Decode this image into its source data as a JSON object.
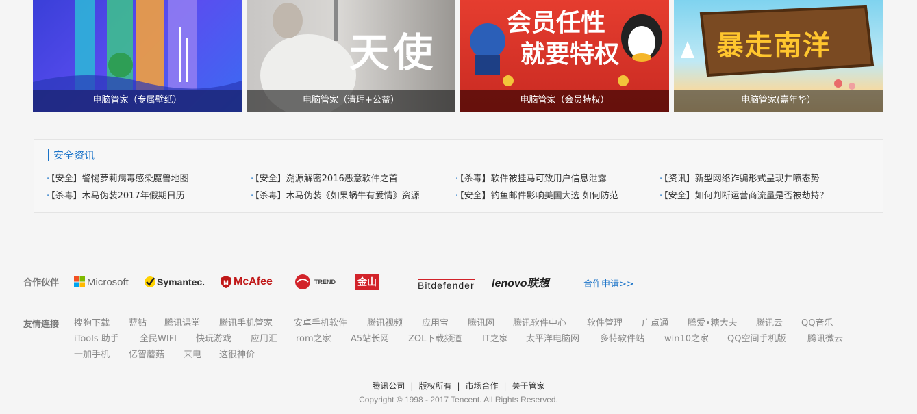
{
  "banners": [
    {
      "caption": "电脑管家（专属壁纸）"
    },
    {
      "caption": "电脑管家（清理+公益）",
      "art_text": "天使"
    },
    {
      "caption": "电脑管家（会员特权）",
      "art_text_1": "会员任性",
      "art_text_2": "就要特权"
    },
    {
      "caption": "电脑管家(嘉年华）",
      "art_text": "暴走南洋"
    }
  ],
  "news": {
    "title": "安全资讯",
    "items": [
      "【安全】警惕萝莉病毒感染魔兽地图",
      "【安全】溯源解密2016恶意软件之首",
      "【杀毒】软件被挂马可致用户信息泄露",
      "【资讯】新型网络诈骗形式呈现井喷态势",
      "【杀毒】木马伪装2017年假期日历",
      "【杀毒】木马伪装《如果蜗牛有爱情》资源",
      "【安全】钓鱼邮件影响美国大选 如何防范",
      "【安全】如何判断运营商流量是否被劫持？"
    ]
  },
  "partners": {
    "label": "合作伙伴",
    "logos": [
      "Microsoft",
      "Symantec.",
      "McAfee",
      "TREND",
      "金山",
      "Bitdefender",
      "lenovo联想"
    ],
    "apply": "合作申请>>"
  },
  "friend_links": {
    "label": "友情连接",
    "items": [
      "搜狗下载",
      "蓝钻",
      "腾讯课堂",
      "腾讯手机管家",
      "安卓手机软件",
      "腾讯视频",
      "应用宝",
      "腾讯网",
      "腾讯软件中心",
      "软件管理",
      "广点通",
      "腾爱•糖大夫",
      "腾讯云",
      "QQ音乐",
      "iTools 助手",
      "全民WIFI",
      "快玩游戏",
      "应用汇",
      "rom之家",
      "A5站长网",
      "ZOL下载频道",
      "IT之家",
      "太平洋电脑网",
      "多特软件站",
      "win10之家",
      "QQ空间手机版",
      "腾讯微云",
      "一加手机",
      "亿智蘑菇",
      "来电",
      "这很神价"
    ]
  },
  "footer": {
    "links": [
      "腾讯公司",
      "版权所有",
      "市场合作",
      "关于管家"
    ],
    "copyright": "Copyright © 1998 - 2017 Tencent. All Rights Reserved."
  },
  "colors": {
    "accent": "#1a73c8",
    "background": "#f5f5f5"
  }
}
